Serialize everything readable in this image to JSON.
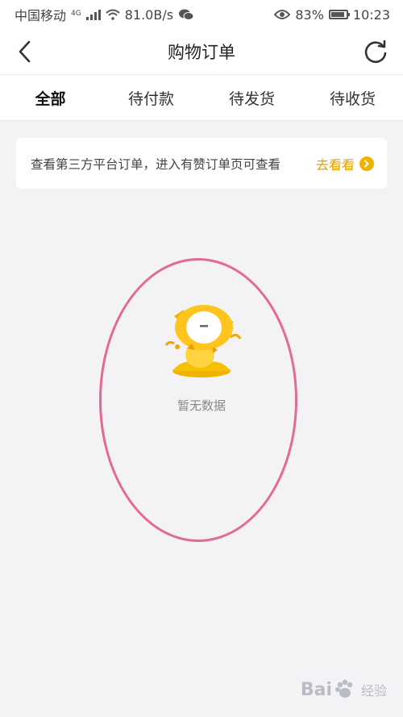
{
  "status_bar": {
    "carrier": "中国移动",
    "network_type": "4G",
    "speed": "81.0B/s",
    "battery": "83%",
    "time": "10:23"
  },
  "header": {
    "title": "购物订单",
    "back_icon": "chevron-left-icon",
    "refresh_icon": "refresh-icon"
  },
  "tabs": [
    {
      "label": "全部",
      "active": true
    },
    {
      "label": "待付款",
      "active": false
    },
    {
      "label": "待发货",
      "active": false
    },
    {
      "label": "待收货",
      "active": false
    }
  ],
  "notice": {
    "text": "查看第三方平台订单，进入有赞订单页可查看",
    "link_label": "去看看"
  },
  "empty_state": {
    "message": "暂无数据"
  },
  "watermark": {
    "brand": "Bai",
    "sub": "经验"
  },
  "colors": {
    "accent": "#e6a100",
    "highlight": "#e26a93",
    "background": "#f3f3f5"
  }
}
